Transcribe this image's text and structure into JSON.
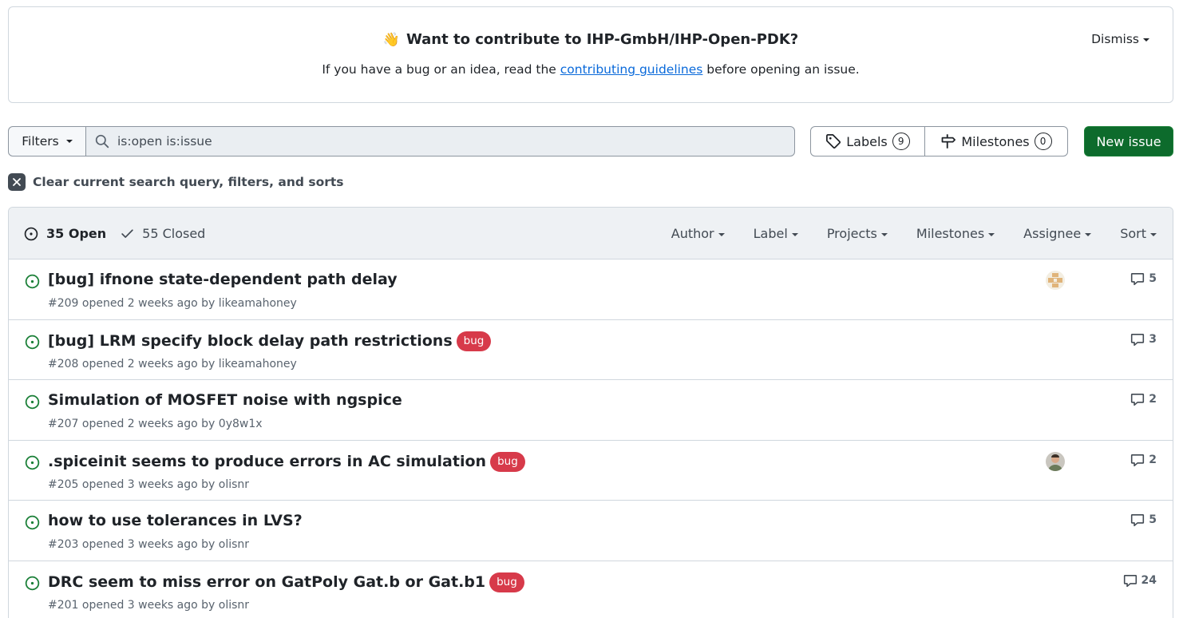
{
  "banner": {
    "emoji": "👋",
    "title": "Want to contribute to IHP-GmbH/IHP-Open-PDK?",
    "text_before": "If you have a bug or an idea, read the ",
    "link": "contributing guidelines",
    "text_after": " before opening an issue.",
    "dismiss": "Dismiss"
  },
  "toolbar": {
    "filters": "Filters",
    "search_value": "is:open is:issue",
    "labels": "Labels",
    "labels_count": "9",
    "milestones": "Milestones",
    "milestones_count": "0",
    "new_issue": "New issue"
  },
  "clear": {
    "label": "Clear current search query, filters, and sorts"
  },
  "list_header": {
    "open": "35 Open",
    "closed": "55 Closed",
    "filters": [
      "Author",
      "Label",
      "Projects",
      "Milestones",
      "Assignee",
      "Sort"
    ]
  },
  "colors": {
    "open_icon": "#1a7f37",
    "bug_label": "#d73a4a",
    "primary_button": "#0d6b2c"
  },
  "issues": [
    {
      "title": "[bug] ifnone state-dependent path delay",
      "label": "",
      "meta": "#209 opened 2 weeks ago by likeamahoney",
      "comments": "5",
      "assignee": "identicon"
    },
    {
      "title": "[bug] LRM specify block delay path restrictions",
      "label": "bug",
      "meta": "#208 opened 2 weeks ago by likeamahoney",
      "comments": "3",
      "assignee": ""
    },
    {
      "title": "Simulation of MOSFET noise with ngspice",
      "label": "",
      "meta": "#207 opened 2 weeks ago by 0y8w1x",
      "comments": "2",
      "assignee": ""
    },
    {
      "title": ".spiceinit seems to produce errors in AC simulation",
      "label": "bug",
      "meta": "#205 opened 3 weeks ago by olisnr",
      "comments": "2",
      "assignee": "photo"
    },
    {
      "title": "how to use tolerances in LVS?",
      "label": "",
      "meta": "#203 opened 3 weeks ago by olisnr",
      "comments": "5",
      "assignee": ""
    },
    {
      "title": "DRC seem to miss error on GatPoly Gat.b or Gat.b1",
      "label": "bug",
      "meta": "#201 opened 3 weeks ago by olisnr",
      "comments": "24",
      "assignee": ""
    }
  ]
}
